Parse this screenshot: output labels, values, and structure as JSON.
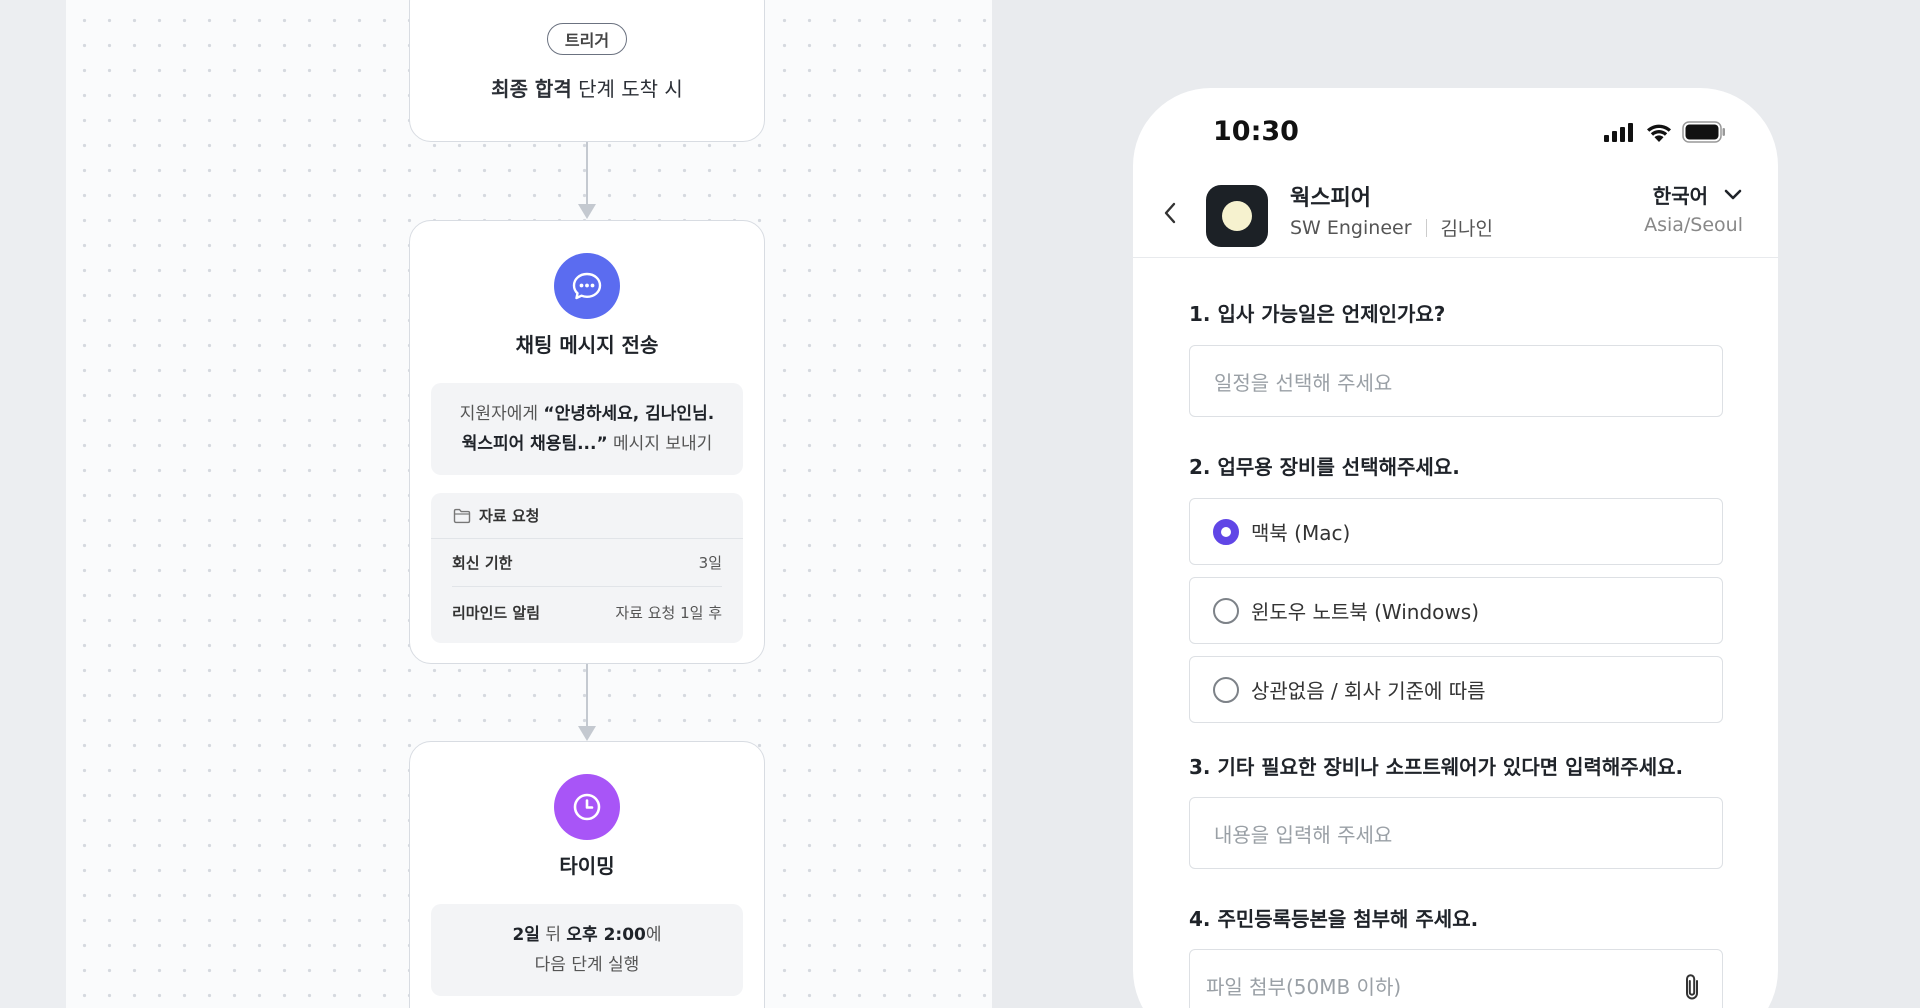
{
  "workflow": {
    "trigger": {
      "tag": "트리거",
      "text_bold": "최종 합격",
      "text_rest": " 단계 도착 시"
    },
    "chat_node": {
      "icon": "chat-bubble-icon",
      "icon_color": "#5b6cf0",
      "title": "채팅 메시지 전송",
      "message_prefix": "지원자에게 ",
      "message_bold_1": "“안녕하세요, 김나인님.",
      "message_bold_2": "웍스피어 채용팀...”",
      "message_suffix": " 메시지 보내기",
      "request_title": "자료 요청",
      "rows": [
        {
          "key": "회신 기한",
          "value": "3일"
        },
        {
          "key": "리마인드 알림",
          "value": "자료 요청 1일 후"
        }
      ]
    },
    "timing_node": {
      "icon": "clock-icon",
      "icon_color": "#a855f7",
      "title": "타이밍",
      "line1_bold_1": "2일",
      "line1_mid": " 뒤 ",
      "line1_bold_2": "오후 2:00",
      "line1_suffix": "에",
      "line2": "다음 단계 실행"
    }
  },
  "phone": {
    "status_time": "10:30",
    "header": {
      "company": "웍스피어",
      "role": "SW Engineer",
      "candidate": "김나인",
      "language": "한국어",
      "timezone": "Asia/Seoul"
    },
    "questions": [
      {
        "label": "1. 입사 가능일은 언제인가요?",
        "placeholder": "일정을 선택해 주세요"
      },
      {
        "label": "2. 업무용 장비를 선택해주세요."
      },
      {
        "label": "3. 기타 필요한 장비나 소프트웨어가 있다면 입력해주세요.",
        "placeholder": "내용을 입력해 주세요"
      },
      {
        "label": "4. 주민등록등본을 첨부해 주세요.",
        "placeholder": "파일 첨부(50MB 이하)"
      }
    ],
    "device_options": [
      {
        "label": "맥북 (Mac)",
        "selected": true
      },
      {
        "label": "윈도우 노트북 (Windows)",
        "selected": false
      },
      {
        "label": "상관없음 / 회사 기준에 따름",
        "selected": false
      }
    ],
    "accent_color": "#6046e6"
  }
}
